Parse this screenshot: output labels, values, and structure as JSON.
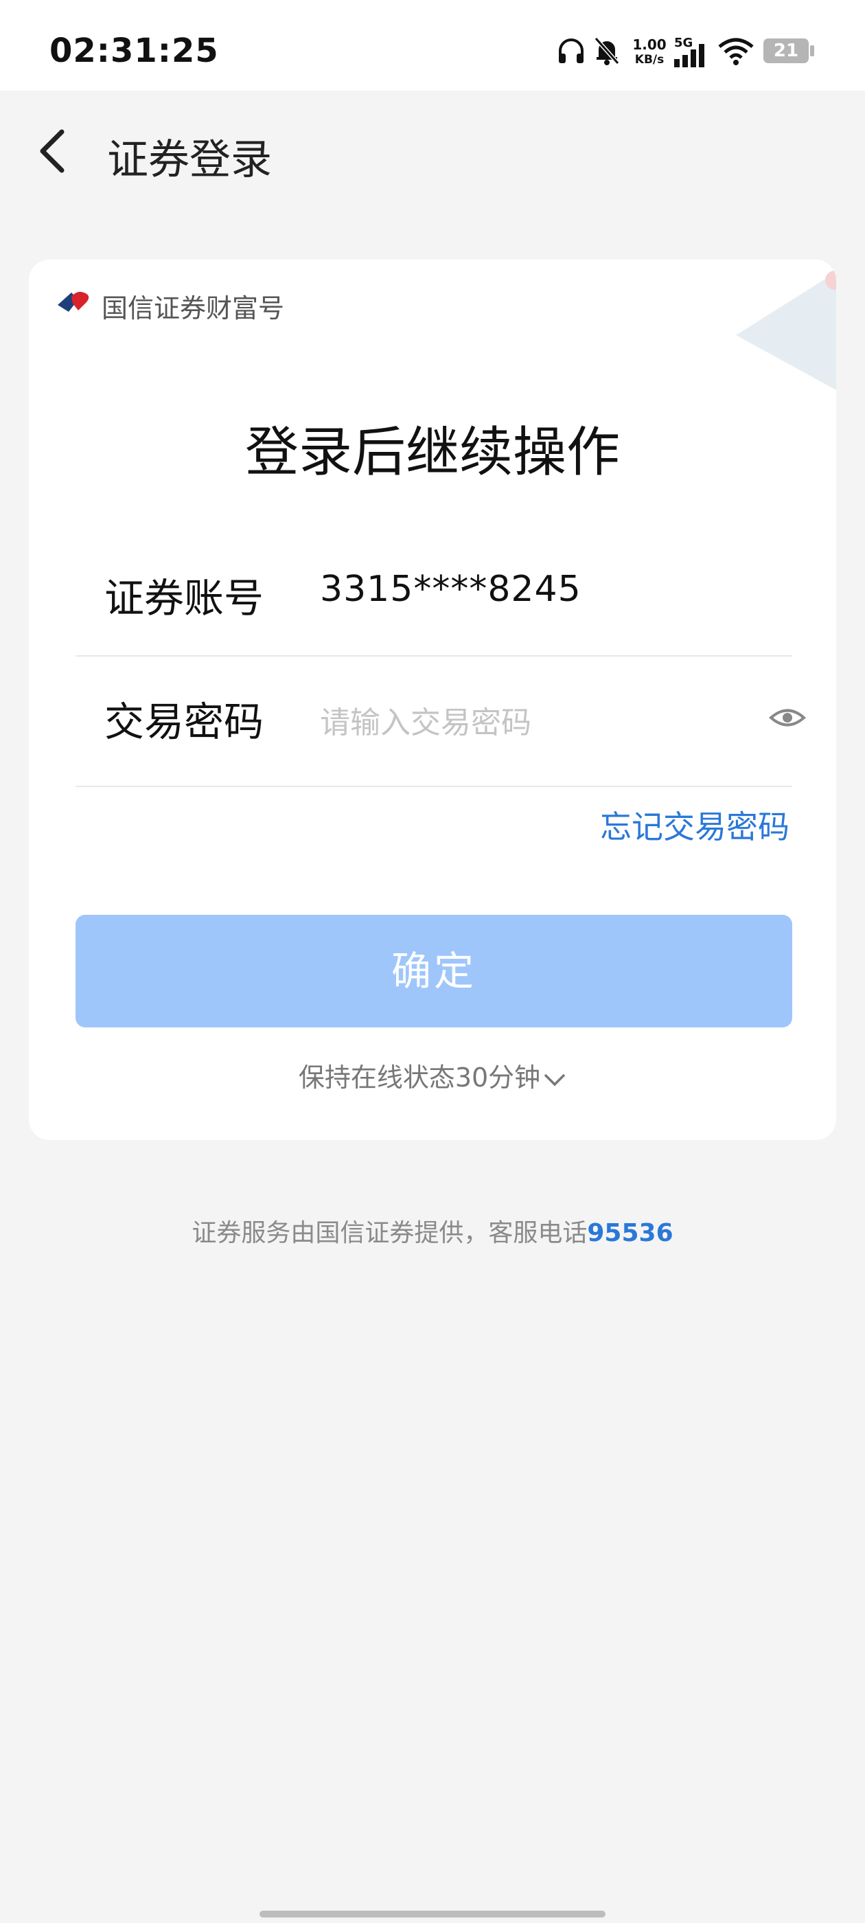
{
  "status_bar": {
    "time": "02:31:25",
    "net_speed_value": "1.00",
    "net_speed_unit": "KB/s",
    "network": "5G",
    "battery": "21",
    "icons": [
      "headphones-icon",
      "mute-bell-icon",
      "signal-icon",
      "wifi-icon",
      "battery-icon"
    ]
  },
  "nav": {
    "title": "证券登录",
    "back_icon": "chevron-left-icon"
  },
  "card": {
    "brand": "国信证券财富号",
    "headline": "登录后继续操作",
    "account_label": "证券账号",
    "account_value": "3315****8245",
    "password_label": "交易密码",
    "password_placeholder": "请输入交易密码",
    "forgot_label": "忘记交易密码",
    "confirm_label": "确定",
    "keep_online_label": "保持在线状态30分钟"
  },
  "footer": {
    "text": "证券服务由国信证券提供，客服电话",
    "phone": "95536"
  },
  "colors": {
    "accent": "#2a78d8",
    "button_disabled": "#9fc6fb",
    "background": "#f4f4f5"
  }
}
